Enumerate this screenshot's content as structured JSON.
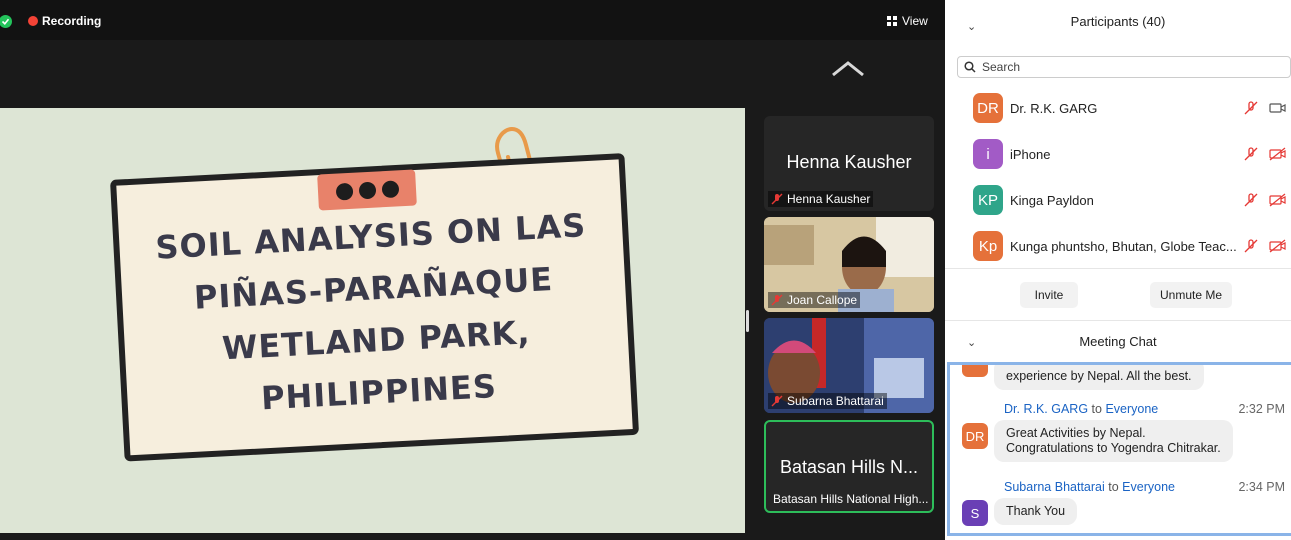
{
  "topbar": {
    "recording": "Recording",
    "view": "View"
  },
  "slide": {
    "title": "SOIL ANALYSIS ON LAS PIÑAS-PARAÑAQUE WETLAND PARK, PHILIPPINES"
  },
  "tiles": [
    {
      "big": "Henna Kausher",
      "label": "Henna Kausher"
    },
    {
      "label": "Joan Callope"
    },
    {
      "label": "Subarna Bhattarai"
    },
    {
      "big": "Batasan Hills N...",
      "label": "Batasan Hills National High..."
    }
  ],
  "participants": {
    "title": "Participants (40)",
    "search_placeholder": "Search",
    "list": [
      {
        "initials": "DR",
        "name": "Dr. R.K. GARG",
        "color": "#e5713a"
      },
      {
        "initials": "i",
        "name": "iPhone",
        "color": "#a25bc6"
      },
      {
        "initials": "KP",
        "name": "Kinga Payldon",
        "color": "#2fa58a"
      },
      {
        "initials": "Kp",
        "name": "Kunga phuntsho, Bhutan, Globe Teac...",
        "color": "#e5713a"
      }
    ],
    "invite": "Invite",
    "unmute": "Unmute Me"
  },
  "chat": {
    "title": "Meeting Chat",
    "messages": [
      {
        "text": "experience by Nepal. All the best."
      },
      {
        "sender": "Dr. R.K. GARG",
        "to": "to",
        "recipient": "Everyone",
        "time": "2:32 PM",
        "initials": "DR",
        "color": "#e5713a",
        "line1": "Great Activities by Nepal.",
        "line2": "Congratulations to Yogendra Chitrakar."
      },
      {
        "sender": "Subarna Bhattarai",
        "to": "to",
        "recipient": "Everyone",
        "time": "2:34 PM",
        "initials": "S",
        "color": "#6a3fb5",
        "line1": "Thank You"
      }
    ]
  }
}
